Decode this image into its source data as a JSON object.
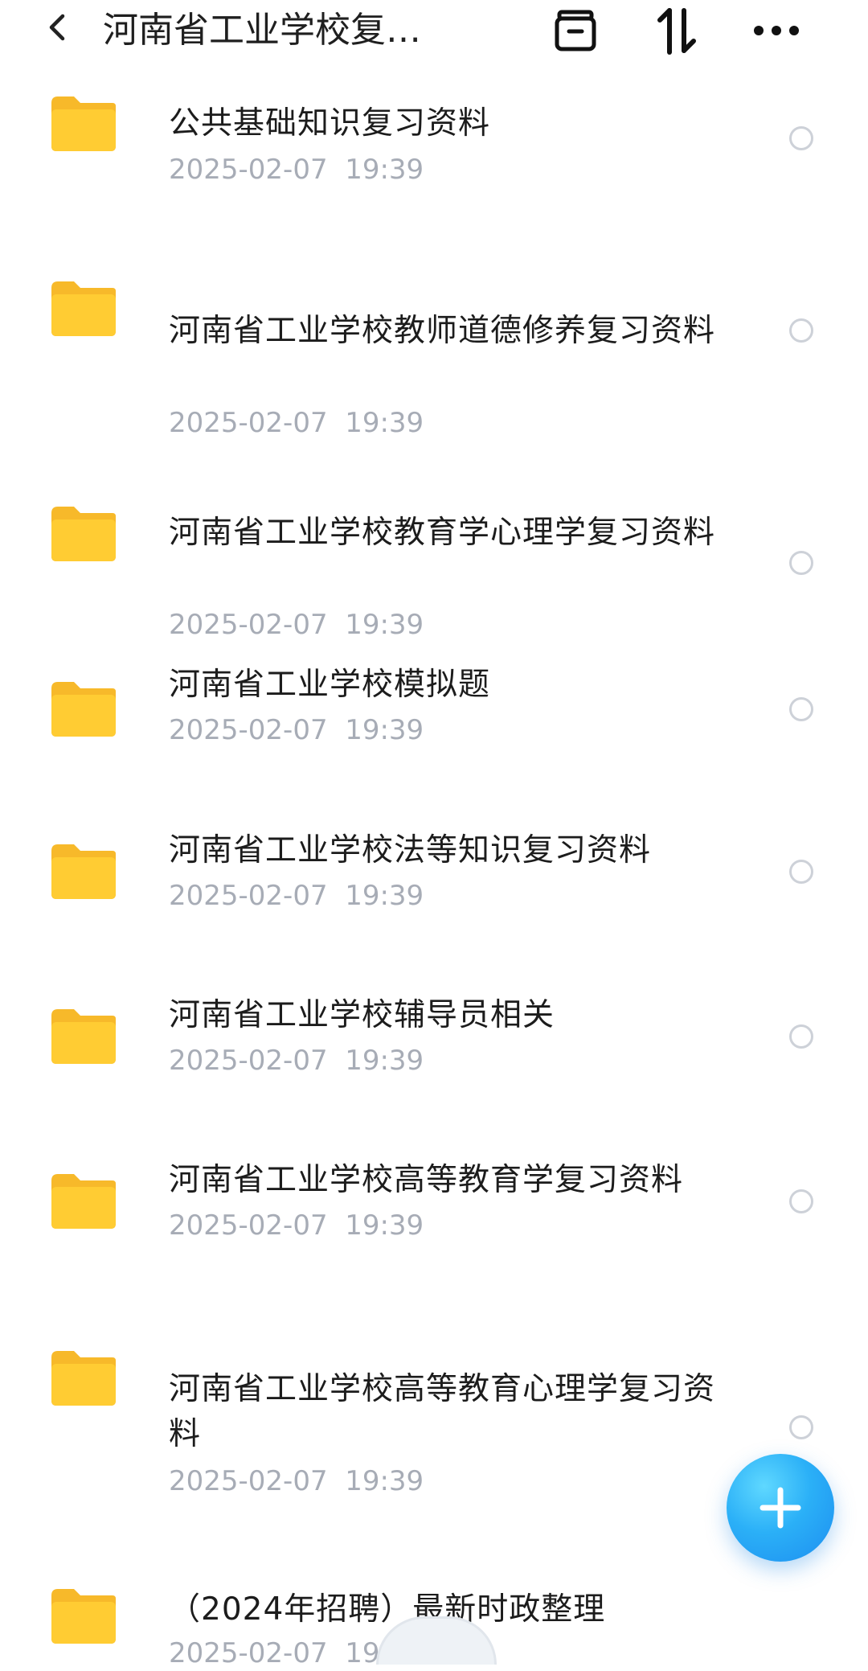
{
  "header": {
    "title": "河南省工业学校复…",
    "icons": [
      "back-icon",
      "archive-icon",
      "sort-icon",
      "more-icon"
    ]
  },
  "folders": [
    {
      "name": "公共基础知识复习资料",
      "date": "2025-02-07  19:39"
    },
    {
      "name": "河南省工业学校教师道德修养复习资料",
      "date": "2025-02-07  19:39"
    },
    {
      "name": "河南省工业学校教育学心理学复习资料",
      "date": "2025-02-07  19:39"
    },
    {
      "name": "河南省工业学校模拟题",
      "date": "2025-02-07  19:39"
    },
    {
      "name": "河南省工业学校法等知识复习资料",
      "date": "2025-02-07  19:39"
    },
    {
      "name": "河南省工业学校辅导员相关",
      "date": "2025-02-07  19:39"
    },
    {
      "name": "河南省工业学校高等教育学复习资料",
      "date": "2025-02-07  19:39"
    },
    {
      "name": "河南省工业学校高等教育心理学复习资料",
      "date": "2025-02-07  19:39"
    },
    {
      "name": "（2024年招聘）最新时政整理",
      "date": "2025-02-07  19:39"
    }
  ],
  "fab": {
    "icon": "plus-icon"
  },
  "colors": {
    "folder": "#FFCB2E",
    "fab": "#2BB0F7",
    "date": "#A7ACB6"
  }
}
